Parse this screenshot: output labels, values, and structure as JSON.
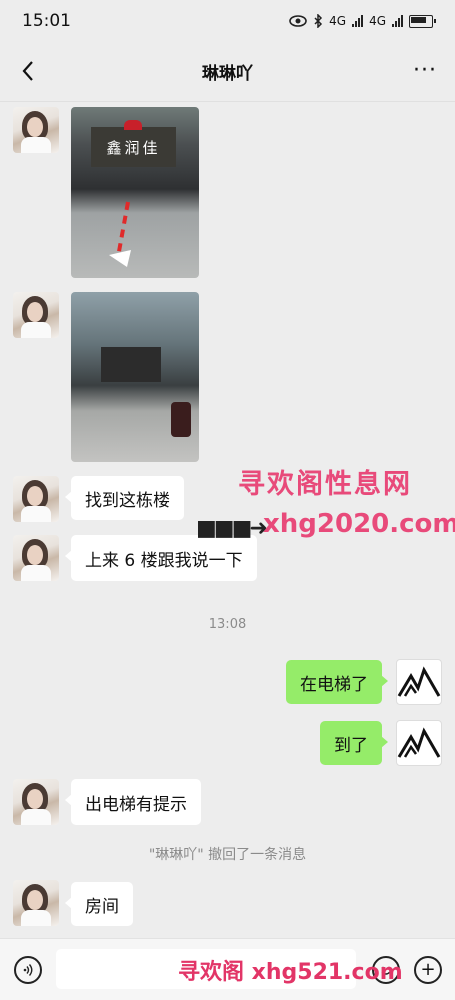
{
  "status_bar": {
    "time": "15:01",
    "net1": "4G",
    "net2": "4G"
  },
  "header": {
    "title": "琳琳吖",
    "more": "···"
  },
  "messages": [
    {
      "type": "image",
      "from": "other"
    },
    {
      "type": "image",
      "from": "other"
    },
    {
      "type": "text",
      "from": "other",
      "text": "找到这栋楼"
    },
    {
      "type": "text",
      "from": "other",
      "text": "上来 6 楼跟我说一下"
    },
    {
      "type": "time",
      "text": "13:08"
    },
    {
      "type": "text",
      "from": "me",
      "text": "在电梯了"
    },
    {
      "type": "text",
      "from": "me",
      "text": "到了"
    },
    {
      "type": "text",
      "from": "other",
      "text": "出电梯有提示"
    },
    {
      "type": "system",
      "text": "\"琳琳吖\" 撤回了一条消息"
    },
    {
      "type": "text",
      "from": "other",
      "text": "房间"
    }
  ],
  "photo1_sign": "鑫润佳",
  "watermarks": {
    "title": "寻欢阁性息网",
    "arrow": "■■■➜",
    "url": "xhg2020.com",
    "bottom": "寻欢阁 xhg521.com"
  },
  "input_bar": {
    "plus": "+"
  }
}
